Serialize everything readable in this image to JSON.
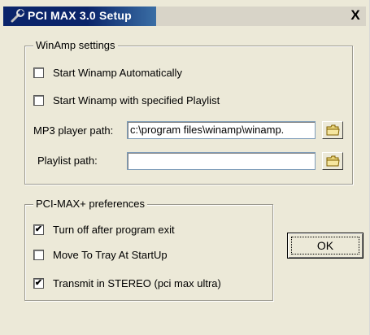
{
  "window": {
    "title": "PCI MAX 3.0 Setup",
    "close_symbol": "X",
    "title_icon": "wrench-icon"
  },
  "winamp": {
    "legend": "WinAmp settings",
    "start_auto": {
      "label": "Start Winamp Automatically",
      "checked": false
    },
    "start_playlist": {
      "label": "Start Winamp with specified Playlist",
      "checked": false
    },
    "mp3_path": {
      "label": "MP3 player path:",
      "value": "c:\\program files\\winamp\\winamp."
    },
    "playlist_path": {
      "label": "Playlist path:",
      "value": ""
    },
    "browse_icon": "folder-icon"
  },
  "prefs": {
    "legend": "PCI-MAX+ preferences",
    "turn_off": {
      "label": "Turn off after program exit",
      "checked": true
    },
    "tray": {
      "label": "Move To Tray At StartUp",
      "checked": false
    },
    "stereo": {
      "label": "Transmit in STEREO (pci max ultra)",
      "checked": true
    }
  },
  "ok_label": "OK",
  "colors": {
    "title_bar": "#0a246a",
    "dialog_bg": "#ece9d8"
  }
}
